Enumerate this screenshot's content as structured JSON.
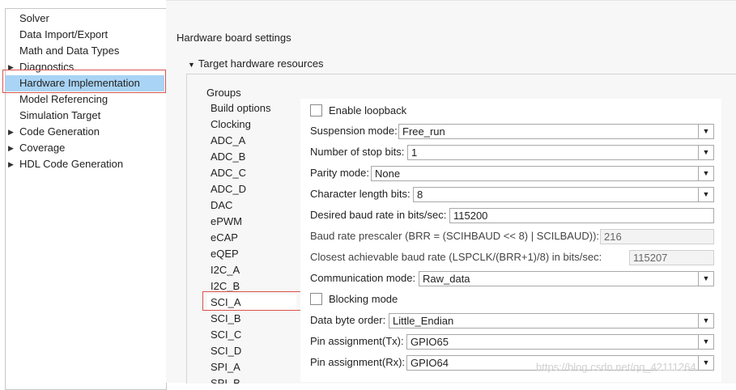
{
  "tree": {
    "items": [
      {
        "label": "Solver",
        "expandable": false,
        "selected": false
      },
      {
        "label": "Data Import/Export",
        "expandable": false,
        "selected": false
      },
      {
        "label": "Math and Data Types",
        "expandable": false,
        "selected": false
      },
      {
        "label": "Diagnostics",
        "expandable": true,
        "selected": false
      },
      {
        "label": "Hardware Implementation",
        "expandable": false,
        "selected": true
      },
      {
        "label": "Model Referencing",
        "expandable": false,
        "selected": false
      },
      {
        "label": "Simulation Target",
        "expandable": false,
        "selected": false
      },
      {
        "label": "Code Generation",
        "expandable": true,
        "selected": false
      },
      {
        "label": "Coverage",
        "expandable": true,
        "selected": false
      },
      {
        "label": "HDL Code Generation",
        "expandable": true,
        "selected": false
      }
    ],
    "arrow_glyph": "▶"
  },
  "settings": {
    "section_title": "Hardware board settings",
    "subsection_title": "Target hardware resources",
    "subsection_arrow": "▼",
    "groups_label": "Groups",
    "groups": [
      "Build options",
      "Clocking",
      "ADC_A",
      "ADC_B",
      "ADC_C",
      "ADC_D",
      "DAC",
      "ePWM",
      "eCAP",
      "eQEP",
      "I2C_A",
      "I2C_B",
      "SCI_A",
      "SCI_B",
      "SCI_C",
      "SCI_D",
      "SPI_A",
      "SPI_B"
    ],
    "active_group": "SCI_A"
  },
  "sci": {
    "enable_loopback": "Enable loopback",
    "suspension_mode_label": "Suspension mode:",
    "suspension_mode_value": "Free_run",
    "stop_bits_label": "Number of stop bits:",
    "stop_bits_value": "1",
    "parity_label": "Parity mode:",
    "parity_value": "None",
    "char_length_label": "Character length bits:",
    "char_length_value": "8",
    "baud_label": "Desired baud rate in bits/sec:",
    "baud_value": "115200",
    "prescaler_label": "Baud rate prescaler (BRR = (SCIHBAUD << 8) | SCILBAUD)):",
    "prescaler_value": "216",
    "closest_label": "Closest achievable baud rate (LSPCLK/(BRR+1)/8) in bits/sec:",
    "closest_value": "115207",
    "comm_mode_label": "Communication mode:",
    "comm_mode_value": "Raw_data",
    "blocking_mode": "Blocking mode",
    "byte_order_label": "Data byte order:",
    "byte_order_value": "Little_Endian",
    "pin_tx_label": "Pin assignment(Tx):",
    "pin_tx_value": "GPIO65",
    "pin_rx_label": "Pin assignment(Rx):",
    "pin_rx_value": "GPIO64",
    "dropdown_glyph": "▼"
  },
  "watermark": "https://blog.csdn.net/qq_42111264",
  "colors": {
    "selection": "#a9d4f5",
    "highlight_outline": "#d9534f"
  }
}
